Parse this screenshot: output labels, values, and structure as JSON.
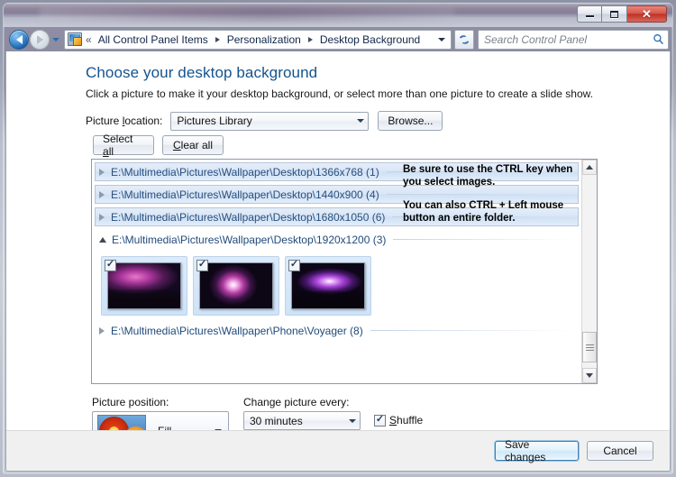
{
  "window": {
    "controls": {
      "minimize": "minimize-button",
      "maximize": "maximize-button",
      "close_label": "✕"
    }
  },
  "navbar": {
    "back_tooltip": "Back",
    "forward_tooltip": "Forward",
    "breadcrumb_prefix": "«",
    "breadcrumbs": [
      {
        "label": "All Control Panel Items"
      },
      {
        "label": "Personalization"
      },
      {
        "label": "Desktop Background"
      }
    ],
    "search": {
      "placeholder": "Search Control Panel",
      "value": ""
    }
  },
  "page": {
    "title": "Choose your desktop background",
    "subtitle": "Click a picture to make it your desktop background, or select more than one picture to create a slide show."
  },
  "picture_location": {
    "label_pre": "Picture ",
    "label_accel": "l",
    "label_post": "ocation:",
    "selected": "Pictures Library",
    "browse_label": "Browse..."
  },
  "selection_buttons": {
    "select_all_pre": "Select ",
    "select_all_accel": "a",
    "select_all_post": "ll",
    "clear_all_pre": "",
    "clear_all_accel": "C",
    "clear_all_post": "lear all"
  },
  "groups": [
    {
      "label": "E:\\Multimedia\\Pictures\\Wallpaper\\Desktop\\1366x768 (1)",
      "expanded": false,
      "count": 1
    },
    {
      "label": "E:\\Multimedia\\Pictures\\Wallpaper\\Desktop\\1440x900 (4)",
      "expanded": false,
      "count": 4
    },
    {
      "label": "E:\\Multimedia\\Pictures\\Wallpaper\\Desktop\\1680x1050 (6)",
      "expanded": false,
      "count": 6
    },
    {
      "label": "E:\\Multimedia\\Pictures\\Wallpaper\\Desktop\\1920x1200 (3)",
      "expanded": true,
      "count": 3
    },
    {
      "label": "E:\\Multimedia\\Pictures\\Wallpaper\\Phone\\Voyager (8)",
      "expanded": false,
      "count": 8
    }
  ],
  "thumbnails": [
    {
      "name": "nebula-horizon-wallpaper",
      "checked": true,
      "selected": true
    },
    {
      "name": "nebula-burst-wallpaper",
      "checked": true,
      "selected": true
    },
    {
      "name": "nebula-wide-wallpaper",
      "checked": true,
      "selected": true
    }
  ],
  "annotation": {
    "line1": "Be sure to use the CTRL key when you select images.",
    "line2": "You can also CTRL + Left mouse button an entire folder."
  },
  "picture_position": {
    "label": "Picture position:",
    "selected": "Fill"
  },
  "change_picture": {
    "label_pre": "Chan",
    "label_accel": "g",
    "label_post": "e picture every:",
    "selected": "30 minutes"
  },
  "shuffle": {
    "label_pre": "",
    "label_accel": "S",
    "label_post": "huffle",
    "checked": true
  },
  "footer": {
    "save_label": "Save changes",
    "cancel_label": "Cancel"
  },
  "colors": {
    "title_blue": "#14538f",
    "group_header_text": "#2b4f7d",
    "selection_blue": "#cfe3f8",
    "default_button_border": "#3c7fb1",
    "close_button_red": "#bf3124"
  }
}
